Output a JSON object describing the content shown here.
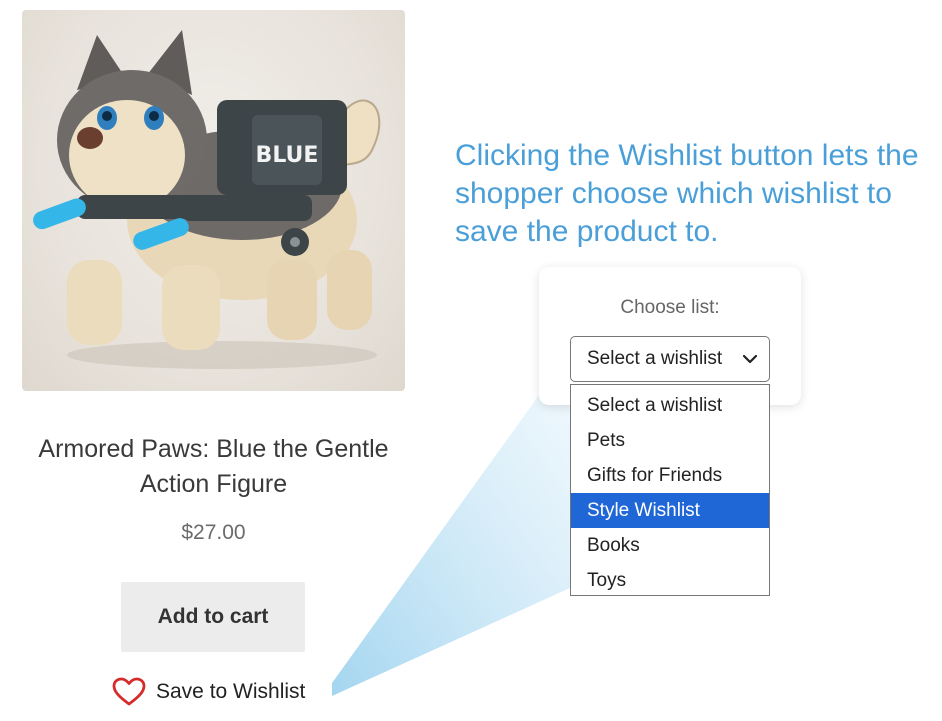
{
  "product": {
    "title": "Armored Paws: Blue the Gentle Action Figure",
    "price": "$27.00",
    "image_badge_text": "BLUE",
    "add_to_cart_label": "Add to cart",
    "wishlist_label": "Save to Wishlist"
  },
  "caption": "Clicking the Wishlist button lets the shopper choose which wishlist to save the product to.",
  "wishlist_popup": {
    "label": "Choose list:",
    "selected_value": "Select a wishlist",
    "options": [
      "Select a wishlist",
      "Pets",
      "Gifts for Friends",
      "Style Wishlist",
      "Books",
      "Toys"
    ],
    "highlighted_option": "Style Wishlist"
  },
  "colors": {
    "accent_blue": "#4a9fd8",
    "highlight": "#1f66d6",
    "heart": "#d62b2b",
    "button_bg": "#ececec"
  },
  "icons": [
    "heart-outline-icon",
    "chevron-down-icon"
  ]
}
